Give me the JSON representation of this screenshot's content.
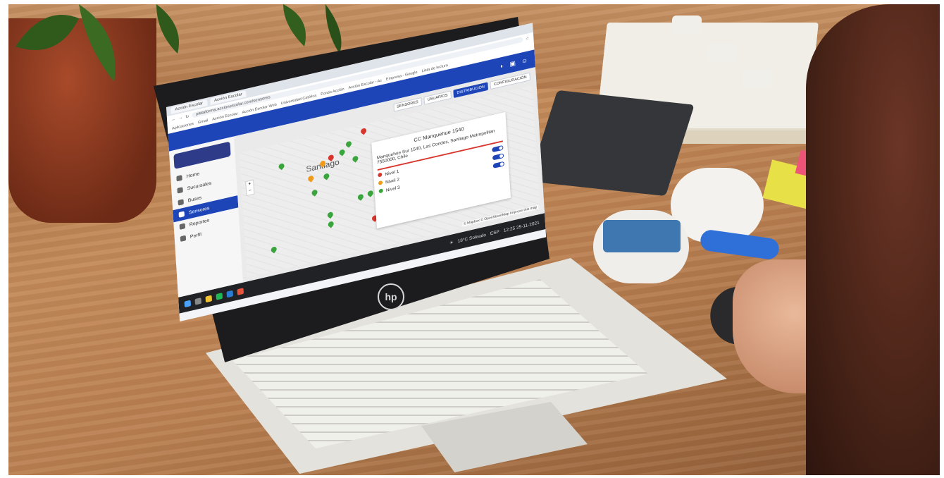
{
  "browser": {
    "tabs": [
      "Acción Escolar",
      "Acción Escolar"
    ],
    "url": "plataforma.accionescolar.com/sensores",
    "bookmarks": [
      "Aplicaciones",
      "Gmail",
      "Acción Escolar",
      "Acción Escolar Web",
      "Universidad Católica",
      "Fondo Acción",
      "Acción Escolar - Ac",
      "Empresa - Google"
    ],
    "reading_list": "Lista de lectura"
  },
  "sidebar": {
    "items": [
      {
        "label": "Home",
        "icon": "home-icon"
      },
      {
        "label": "Sucursales",
        "icon": "building-icon"
      },
      {
        "label": "Buses",
        "icon": "bus-icon"
      },
      {
        "label": "Sensores",
        "icon": "sensor-icon",
        "active": true
      },
      {
        "label": "Reportes",
        "icon": "report-icon"
      },
      {
        "label": "Perfil",
        "icon": "gear-icon"
      }
    ]
  },
  "toolbar": {
    "buttons": [
      "SENSORES",
      "USUARIOS",
      "DISTRIBUCIÓN",
      "CONFIGURACIÓN"
    ],
    "active": "DISTRIBUCIÓN"
  },
  "map": {
    "city_label": "Santiago",
    "attribution": "© Mapbox © OpenStreetMap Improve this map",
    "popup": {
      "title": "CC Manquehue 1540",
      "address": "Manquehue Sur 1540, Las Condes, Santiago Metropolitan 7550000, Chile",
      "legend": [
        "Nivel 1",
        "Nivel 2",
        "Nivel 3"
      ]
    }
  },
  "taskbar": {
    "weather": "18°C Soleado",
    "time": "12:25",
    "date": "25-11-2021",
    "lang": "ESP"
  },
  "colors": {
    "accent": "#1d45b8",
    "pin_green": "#3aa53c",
    "pin_orange": "#f09a1a",
    "pin_red": "#d8362c"
  }
}
